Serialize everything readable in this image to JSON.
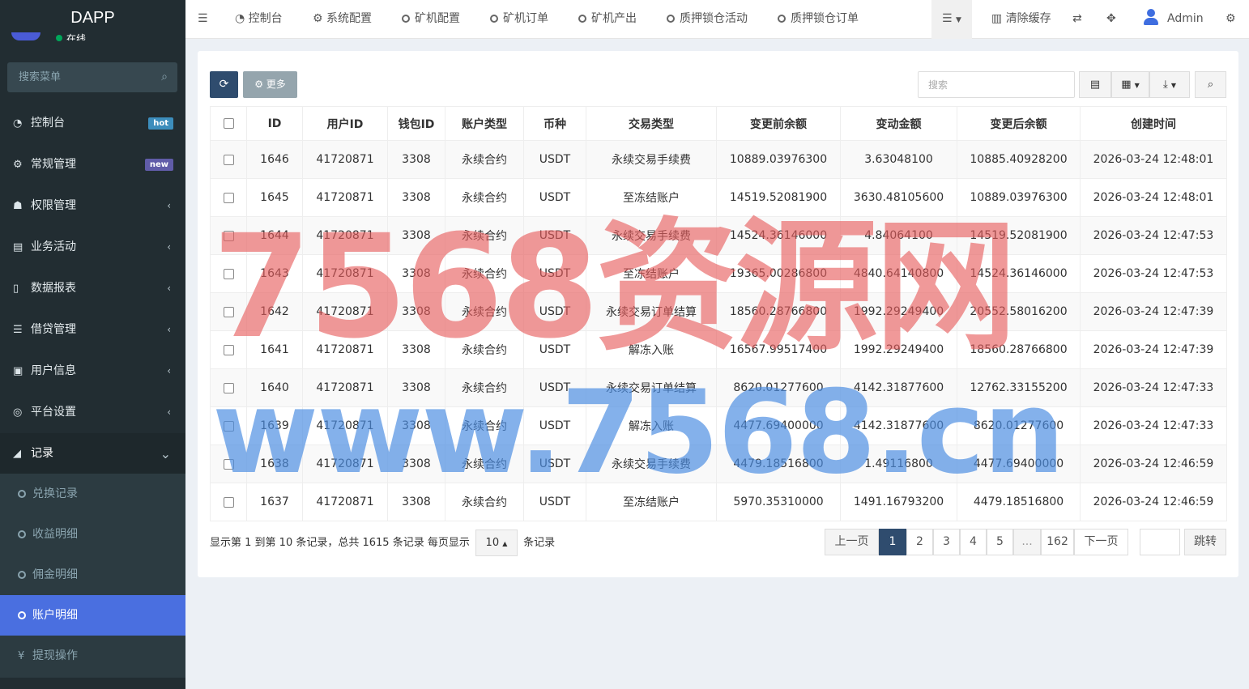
{
  "sidebar": {
    "brand": "DAPP",
    "user_status": "在线",
    "search_placeholder": "搜索菜单",
    "items": [
      {
        "label": "控制台",
        "icon": "dashboard-icon",
        "glyph": "◔",
        "badge": "hot"
      },
      {
        "label": "常规管理",
        "icon": "cogs-icon",
        "glyph": "⚙",
        "badge": "new"
      },
      {
        "label": "权限管理",
        "icon": "users-icon",
        "glyph": "☗",
        "chevron": "‹"
      },
      {
        "label": "业务活动",
        "icon": "card-icon",
        "glyph": "▤",
        "chevron": "‹"
      },
      {
        "label": "数据报表",
        "icon": "file-icon",
        "glyph": "▯",
        "chevron": "‹"
      },
      {
        "label": "借贷管理",
        "icon": "list-icon",
        "glyph": "☰",
        "chevron": "‹"
      },
      {
        "label": "用户信息",
        "icon": "address-book-icon",
        "glyph": "▣",
        "chevron": "‹"
      },
      {
        "label": "平台设置",
        "icon": "circle-dot-icon",
        "glyph": "◎",
        "chevron": "‹"
      },
      {
        "label": "记录",
        "icon": "area-chart-icon",
        "glyph": "◢",
        "chevron": "⌄"
      }
    ],
    "sub_items": [
      {
        "label": "兑换记录"
      },
      {
        "label": "收益明细"
      },
      {
        "label": "佣金明细"
      },
      {
        "label": "账户明细"
      },
      {
        "label": "提现操作",
        "glyph": "¥"
      }
    ]
  },
  "topnav": {
    "tabs": [
      "控制台",
      "系统配置",
      "矿机配置",
      "矿机订单",
      "矿机产出",
      "质押锁仓活动",
      "质押锁仓订单"
    ],
    "clear_cache": "清除缓存",
    "admin": "Admin"
  },
  "toolbar": {
    "more_label": "更多",
    "search_placeholder": "搜索"
  },
  "table": {
    "headers": [
      "ID",
      "用户ID",
      "钱包ID",
      "账户类型",
      "币种",
      "交易类型",
      "变更前余额",
      "变动金额",
      "变更后余额",
      "创建时间"
    ],
    "rows": [
      [
        "1646",
        "41720871",
        "3308",
        "永续合约",
        "USDT",
        "永续交易手续费",
        "10889.03976300",
        "3.63048100",
        "10885.40928200",
        "2026-03-24 12:48:01"
      ],
      [
        "1645",
        "41720871",
        "3308",
        "永续合约",
        "USDT",
        "至冻结账户",
        "14519.52081900",
        "3630.48105600",
        "10889.03976300",
        "2026-03-24 12:48:01"
      ],
      [
        "1644",
        "41720871",
        "3308",
        "永续合约",
        "USDT",
        "永续交易手续费",
        "14524.36146000",
        "4.84064100",
        "14519.52081900",
        "2026-03-24 12:47:53"
      ],
      [
        "1643",
        "41720871",
        "3308",
        "永续合约",
        "USDT",
        "至冻结账户",
        "19365.00286800",
        "4840.64140800",
        "14524.36146000",
        "2026-03-24 12:47:53"
      ],
      [
        "1642",
        "41720871",
        "3308",
        "永续合约",
        "USDT",
        "永续交易订单结算",
        "18560.28766800",
        "1992.29249400",
        "20552.58016200",
        "2026-03-24 12:47:39"
      ],
      [
        "1641",
        "41720871",
        "3308",
        "永续合约",
        "USDT",
        "解冻入账",
        "16567.99517400",
        "1992.29249400",
        "18560.28766800",
        "2026-03-24 12:47:39"
      ],
      [
        "1640",
        "41720871",
        "3308",
        "永续合约",
        "USDT",
        "永续交易订单结算",
        "8620.01277600",
        "4142.31877600",
        "12762.33155200",
        "2026-03-24 12:47:33"
      ],
      [
        "1639",
        "41720871",
        "3308",
        "永续合约",
        "USDT",
        "解冻入账",
        "4477.69400000",
        "4142.31877600",
        "8620.01277600",
        "2026-03-24 12:47:33"
      ],
      [
        "1638",
        "41720871",
        "3308",
        "永续合约",
        "USDT",
        "永续交易手续费",
        "4479.18516800",
        "1.49116800",
        "4477.69400000",
        "2026-03-24 12:46:59"
      ],
      [
        "1637",
        "41720871",
        "3308",
        "永续合约",
        "USDT",
        "至冻结账户",
        "5970.35310000",
        "1491.16793200",
        "4479.18516800",
        "2026-03-24 12:46:59"
      ]
    ]
  },
  "pagination": {
    "info_prefix": "显示第 1 到第 10 条记录，总共 1615 条记录 每页显示",
    "page_size": "10",
    "info_suffix": "条记录",
    "prev": "上一页",
    "pages": [
      "1",
      "2",
      "3",
      "4",
      "5",
      "...",
      "162"
    ],
    "next": "下一页",
    "jump": "跳转"
  },
  "watermark": {
    "line1": "7568资源网",
    "line2": "www.7568.cn"
  }
}
